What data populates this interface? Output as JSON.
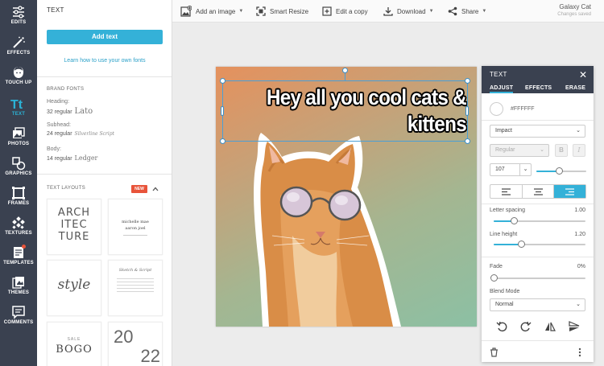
{
  "nav": {
    "items": [
      {
        "label": "EDITS",
        "icon": "sliders-icon"
      },
      {
        "label": "EFFECTS",
        "icon": "magic-wand-icon"
      },
      {
        "label": "TOUCH UP",
        "icon": "face-icon"
      },
      {
        "label": "TEXT",
        "icon": "text-tt-icon",
        "active": true
      },
      {
        "label": "PHOTOS",
        "icon": "photos-icon"
      },
      {
        "label": "GRAPHICS",
        "icon": "shapes-icon"
      },
      {
        "label": "FRAMES",
        "icon": "frame-icon"
      },
      {
        "label": "TEXTURES",
        "icon": "texture-icon"
      },
      {
        "label": "TEMPLATES",
        "icon": "templates-icon",
        "dot": true
      },
      {
        "label": "THEMES",
        "icon": "themes-icon"
      },
      {
        "label": "COMMENTS",
        "icon": "comment-icon"
      }
    ]
  },
  "panel": {
    "title": "TEXT",
    "add_text": "Add text",
    "learn_link": "Learn how to use your own fonts",
    "brand_fonts": {
      "title": "BRAND FONTS",
      "heading_label": "Heading:",
      "heading_value": "32 regular",
      "heading_font": "Lato",
      "subhead_label": "Subhead:",
      "subhead_value": "24 regular",
      "subhead_font": "Silverline Script",
      "body_label": "Body:",
      "body_value": "14 regular",
      "body_font": "Ledger"
    },
    "layouts": {
      "title": "TEXT LAYOUTS",
      "badge": "NEW",
      "tiles": [
        {
          "lines": [
            "ARCH",
            "ITEC",
            "TURE"
          ]
        },
        {
          "lines": [
            "michelle mae",
            "aaron joel"
          ]
        },
        {
          "lines": [
            "style"
          ]
        },
        {
          "lines": [
            "Sketch & Script"
          ]
        },
        {
          "lines": [
            "SALE",
            "BOGO"
          ]
        },
        {
          "lines": [
            "20",
            "22"
          ]
        }
      ]
    }
  },
  "topbar": {
    "add_image": "Add an image",
    "smart_resize": "Smart Resize",
    "edit_copy": "Edit a copy",
    "download": "Download",
    "share": "Share",
    "doc_name": "Galaxy Cat",
    "doc_status": "Changes saved"
  },
  "canvas": {
    "headline": "Hey all you cool cats & kittens"
  },
  "props": {
    "title": "TEXT",
    "tabs": [
      "ADJUST",
      "EFFECTS",
      "ERASE"
    ],
    "color": "#FFFFFF",
    "font": "Impact",
    "weight": "Regular",
    "bold": "B",
    "italic": "I",
    "size": "107",
    "size_slider": 0.45,
    "align": "right",
    "letter_spacing_label": "Letter spacing",
    "letter_spacing_value": "1.00",
    "letter_spacing_level": 0.22,
    "line_height_label": "Line height",
    "line_height_value": "1.20",
    "line_height_level": 0.3,
    "fade_label": "Fade",
    "fade_value": "0%",
    "fade_level": 0,
    "blend_label": "Blend Mode",
    "blend_value": "Normal"
  },
  "colors": {
    "accent": "#34b1d8",
    "nav_bg": "#3a4150",
    "new_badge": "#e8543a"
  }
}
